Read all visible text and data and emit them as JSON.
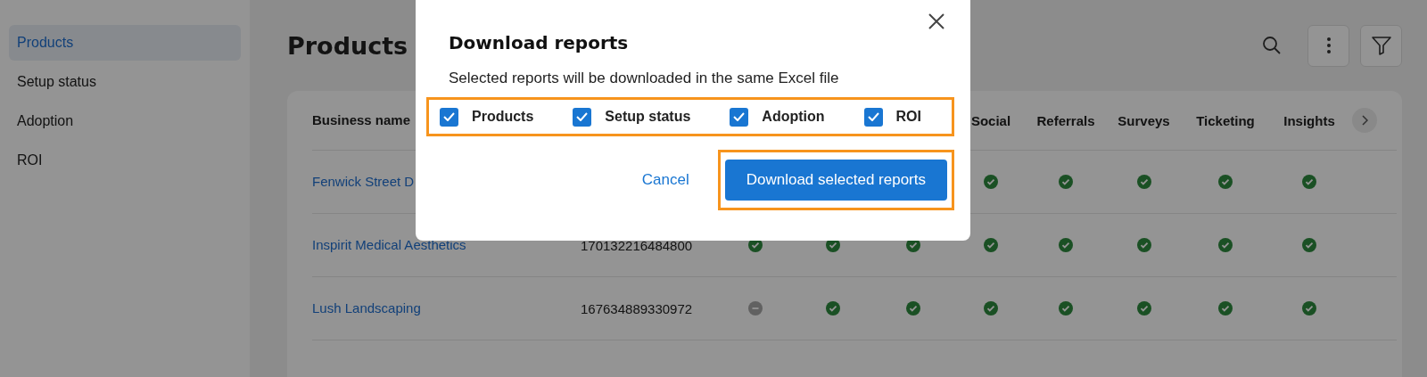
{
  "sidebar": {
    "items": [
      {
        "label": "Products",
        "selected": true
      },
      {
        "label": "Setup status",
        "selected": false
      },
      {
        "label": "Adoption",
        "selected": false
      },
      {
        "label": "ROI",
        "selected": false
      }
    ]
  },
  "page": {
    "title": "Products"
  },
  "table": {
    "columns": [
      "Business name",
      "Social",
      "Referrals",
      "Surveys",
      "Ticketing",
      "Insights"
    ],
    "rows": [
      {
        "name": "Fenwick Street D",
        "statuses": [
          {
            "complete": true
          },
          {
            "complete": true
          },
          {
            "complete": true
          },
          {
            "complete": true
          },
          {
            "complete": true
          }
        ]
      },
      {
        "name": "Inspirit Medical Aesthetics",
        "id": "170132216484800",
        "statuses": [
          {
            "complete": true
          },
          {
            "complete": true
          },
          {
            "complete": true
          },
          {
            "complete": true
          },
          {
            "complete": true
          },
          {
            "complete": true
          },
          {
            "complete": true
          },
          {
            "complete": true
          }
        ]
      },
      {
        "name": "Lush Landscaping",
        "id": "167634889330972",
        "statuses": [
          {
            "complete": false
          },
          {
            "complete": true
          },
          {
            "complete": true
          },
          {
            "complete": true
          },
          {
            "complete": true
          },
          {
            "complete": true
          },
          {
            "complete": true
          },
          {
            "complete": true
          }
        ]
      }
    ]
  },
  "dialog": {
    "title": "Download reports",
    "description": "Selected reports will be downloaded in the same Excel file",
    "options": [
      {
        "label": "Products",
        "checked": true
      },
      {
        "label": "Setup status",
        "checked": true
      },
      {
        "label": "Adoption",
        "checked": true
      },
      {
        "label": "ROI",
        "checked": true
      }
    ],
    "cancel": "Cancel",
    "confirm": "Download selected reports"
  }
}
